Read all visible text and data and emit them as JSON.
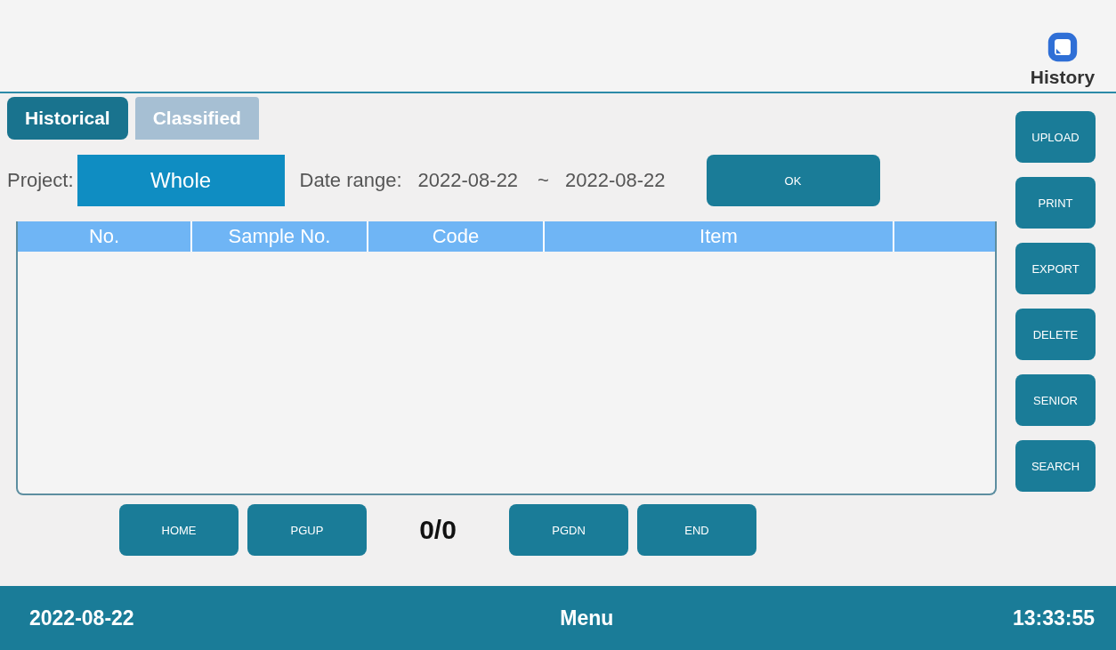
{
  "header": {
    "app_label": "History"
  },
  "tabs": [
    {
      "label": "Historical",
      "selected": true
    },
    {
      "label": "Classified",
      "selected": false
    }
  ],
  "filter": {
    "project_label": "Project:",
    "project_value": "Whole",
    "date_label": "Date range:",
    "date_from": "2022-08-22",
    "date_separator": "~",
    "date_to": "2022-08-22",
    "ok_button": "OK"
  },
  "table": {
    "columns": [
      "No.",
      "Sample No.",
      "Code",
      "Item"
    ]
  },
  "pager": {
    "buttons_before": [
      "HOME",
      "PGUP"
    ],
    "count": "0/0",
    "buttons_after": [
      "PGDN",
      "END"
    ]
  },
  "side_buttons": [
    "UPLOAD",
    "PRINT",
    "EXPORT",
    "DELETE",
    "SENIOR",
    "SEARCH"
  ],
  "status_bar": {
    "date": "2022-08-22",
    "menu": "Menu",
    "time": "13:33:55"
  }
}
